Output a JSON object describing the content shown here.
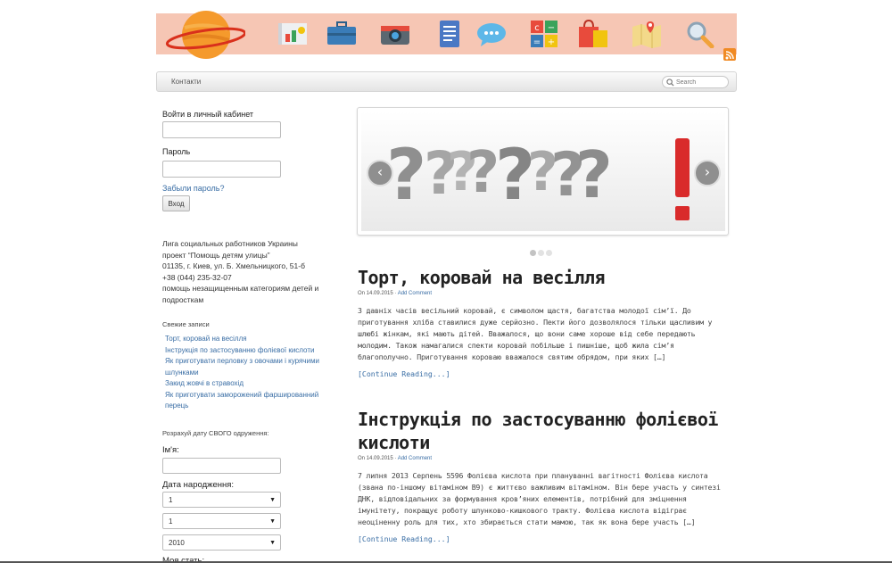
{
  "header": {
    "icons": [
      "planet-logo",
      "chart-icon",
      "briefcase-icon",
      "camera-icon",
      "document-icon",
      "chat-icon",
      "calculator-icon",
      "shopping-bag-icon",
      "map-icon",
      "search-icon"
    ]
  },
  "nav": {
    "link": "Контакти",
    "search_placeholder": "Search"
  },
  "sidebar": {
    "login_label": "Войти в личный кабинет",
    "password_label": "Пароль",
    "forgot_link": "Забыли пароль?",
    "login_button": "Вход",
    "info_lines": [
      "Лига социальных работников Украины",
      "проект “Помощь детям улицы”",
      "01135, г. Киев, ул. Б. Хмельницкого, 51-б",
      "+38 (044) 235-32-07",
      "помощь незащищенным категориям детей и подросткам"
    ],
    "recent_title": "Свежие записи",
    "recent_posts": [
      "Торт, коровай на весілля",
      "Інструкція по застосуванню фолієвої кислоти",
      "Як приготувати перловку з овочами і курячими шлунками",
      "Закид жовчі в стравохід",
      "Як приготувати заморожений фаршированний перець"
    ],
    "calc_title": "Розрахуй дату СВОГО одруження:",
    "name_label": "Ім'я:",
    "birth_label": "Дата народження:",
    "day_value": "1",
    "month_value": "1",
    "year_value": "2010",
    "gender_label": "Моя стать:"
  },
  "slider": {
    "prev_icon": "chevron-left-icon",
    "next_icon": "chevron-right-icon",
    "slide_count": 3,
    "active_slide": 1
  },
  "posts": [
    {
      "title": "Торт, коровай на весілля",
      "meta_prefix": "On 14.09.2015 · ",
      "meta_link": "Add Comment",
      "excerpt": "З давніх часів весільний коровай, є символом щастя, багатства молодої сім’ї. До приготування хліба ставилися дуже серйозно. Пекти його дозволялося тільки щасливим у шлюбі жінкам, які мають дітей. Вважалося, що вони саме хороше від себе передають молодим. Також намагалися спекти коровай побільше і пишніше, щоб жила сім’я благополучно. Приготування короваю вважалося святим обрядом, при яких […]",
      "continue": "[Continue Reading...]"
    },
    {
      "title": "Інструкція по застосуванню фолієвої кислоти",
      "meta_prefix": "On 14.09.2015 · ",
      "meta_link": "Add Comment",
      "excerpt": "7 липня 2013 Серпень 5596 Фолієва кислота при плануванні вагітності Фолієва кислота (звана по-іншому вітаміном В9) є життєво важливим вітаміном. Він бере участь у синтезі ДНК, відповідальних за формування кров’яних елементів, потрібний для зміцнення імунітету, покращує роботу шлунково-кишкового тракту. Фолієва кислота відіграє неоціненну роль для тих, хто збирається стати мамою, так як вона бере участь […]",
      "continue": "[Continue Reading...]"
    }
  ],
  "colors": {
    "banner": "#f6c6b4",
    "link": "#3a6ea5",
    "rss": "#f08a24"
  }
}
